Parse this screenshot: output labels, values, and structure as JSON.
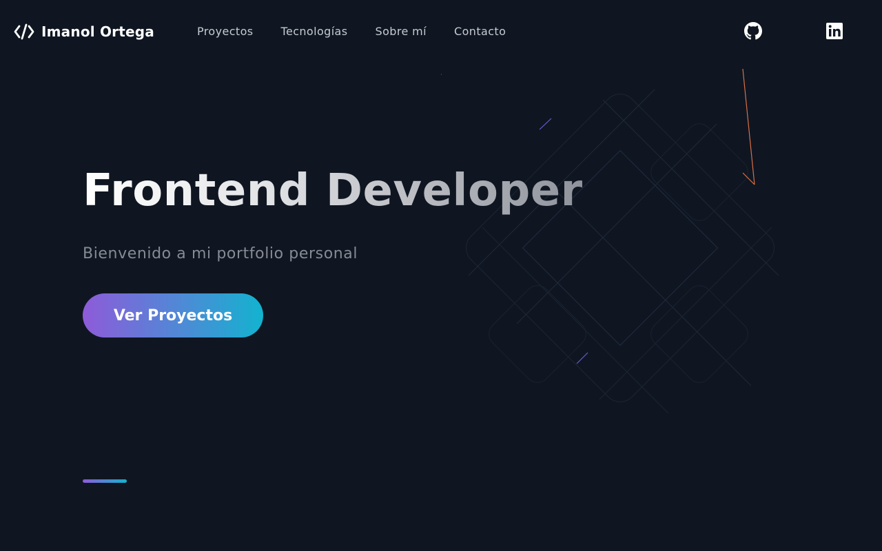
{
  "header": {
    "logo_text": "Imanol Ortega",
    "nav": [
      {
        "label": "Proyectos"
      },
      {
        "label": "Tecnologías"
      },
      {
        "label": "Sobre mí"
      },
      {
        "label": "Contacto"
      }
    ],
    "social_icons": [
      "github-icon",
      "linkedin-icon"
    ]
  },
  "hero": {
    "title": "Frontend Developer",
    "subtitle": "Bienvenido a mi portfolio personal",
    "cta_label": "Ver Proyectos"
  },
  "colors": {
    "background": "#0f1621",
    "accent_start": "#8e5bd9",
    "accent_end": "#12b3cf",
    "nav_text": "#c7cad1",
    "subtitle_text": "#868b95"
  }
}
